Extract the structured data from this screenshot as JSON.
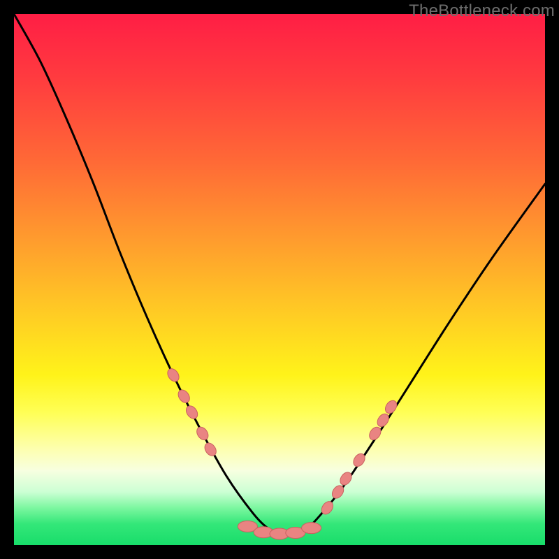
{
  "watermark": "TheBottleneck.com",
  "colors": {
    "frame": "#000000",
    "curve": "#000000",
    "marker": "#e98482",
    "marker_border": "#c9615f"
  },
  "chart_data": {
    "type": "line",
    "title": "",
    "xlabel": "",
    "ylabel": "",
    "xlim": [
      0,
      100
    ],
    "ylim": [
      0,
      100
    ],
    "series": [
      {
        "name": "bottleneck-curve",
        "x": [
          0,
          5,
          10,
          15,
          20,
          25,
          30,
          35,
          40,
          45,
          48,
          50,
          52,
          55,
          58,
          62,
          68,
          75,
          82,
          90,
          100
        ],
        "values": [
          100,
          91,
          80,
          68,
          55,
          43,
          32,
          22,
          13,
          6,
          3,
          2,
          2,
          3,
          6,
          11,
          20,
          31,
          42,
          54,
          68
        ]
      }
    ],
    "markers": {
      "left_descent": [
        [
          30,
          32
        ],
        [
          32,
          28
        ],
        [
          33.5,
          25
        ],
        [
          35.5,
          21
        ],
        [
          37,
          18
        ]
      ],
      "trough": [
        [
          44,
          3.5
        ],
        [
          47,
          2.4
        ],
        [
          50,
          2.1
        ],
        [
          53,
          2.3
        ],
        [
          56,
          3.2
        ]
      ],
      "right_ascent": [
        [
          59,
          7
        ],
        [
          61,
          10
        ],
        [
          62.5,
          12.5
        ],
        [
          65,
          16
        ],
        [
          68,
          21
        ],
        [
          69.5,
          23.5
        ],
        [
          71,
          26
        ]
      ]
    },
    "gradient_stops": [
      {
        "pos": 0,
        "color": "#ff1e45"
      },
      {
        "pos": 28,
        "color": "#ff6a36"
      },
      {
        "pos": 55,
        "color": "#ffc725"
      },
      {
        "pos": 75,
        "color": "#ffff55"
      },
      {
        "pos": 90,
        "color": "#ccffd4"
      },
      {
        "pos": 100,
        "color": "#18dd6a"
      }
    ]
  }
}
